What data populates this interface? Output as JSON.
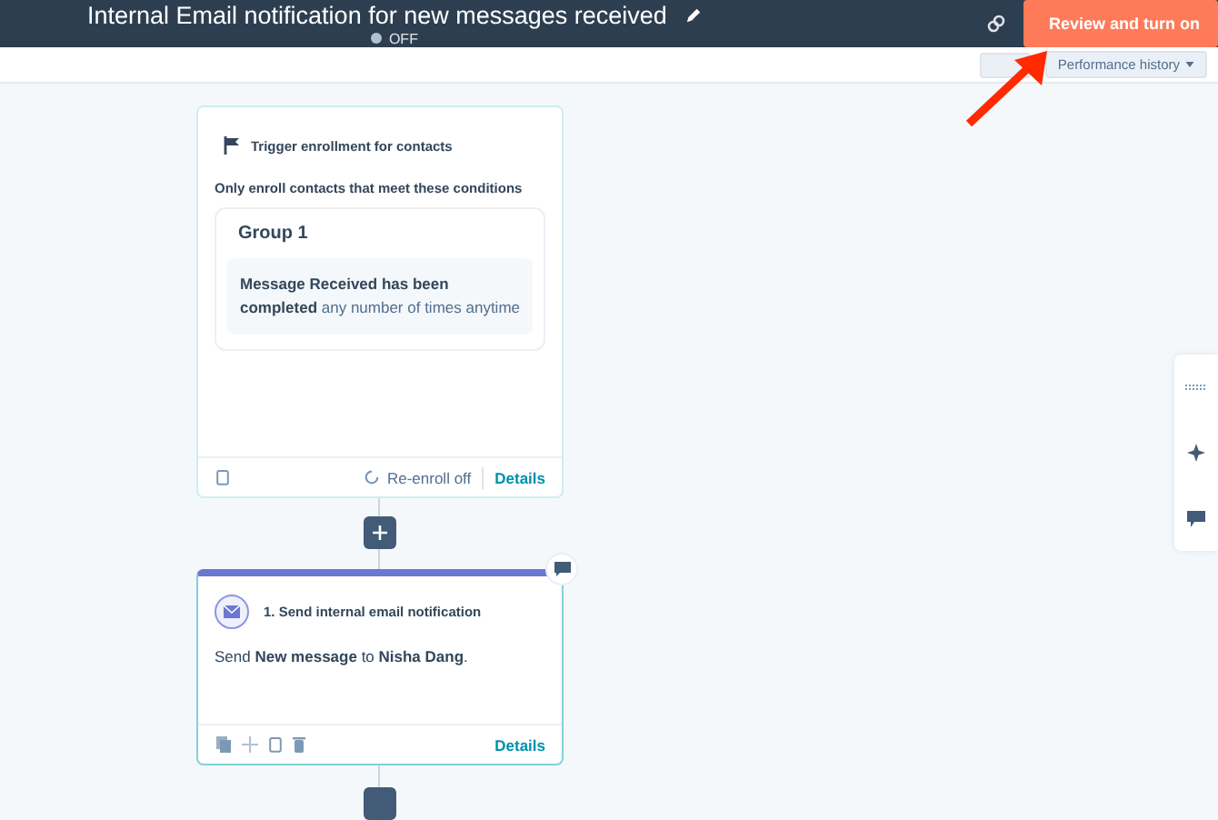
{
  "header": {
    "title": "Internal Email notification for new messages received",
    "status": "OFF",
    "status_on": false,
    "primary_button": "Review and turn on"
  },
  "toolbar": {
    "performance_button": "Performance history"
  },
  "trigger": {
    "heading": "Trigger enrollment for contacts",
    "subheading": "Only enroll contacts that meet these conditions",
    "group_title": "Group 1",
    "condition": "**Message Received has been completed** any number of times anytime",
    "reenroll": "Re-enroll off",
    "details": "Details"
  },
  "action": {
    "title": "1. Send internal email notification",
    "body": "Send **New message** to **Nisha Dang**.",
    "details": "Details"
  }
}
